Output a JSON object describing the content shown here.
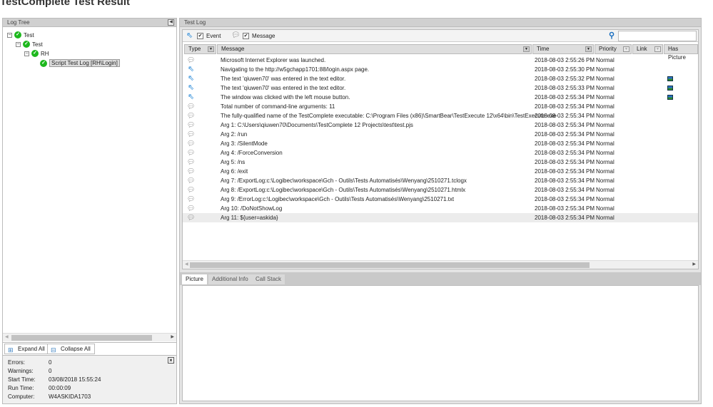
{
  "title": "TestComplete Test Result",
  "log_tree": {
    "header": "Log Tree",
    "nodes": [
      {
        "label": "Test"
      },
      {
        "label": "Test"
      },
      {
        "label": "RH"
      },
      {
        "label": "Script Test Log [RH\\Login]"
      }
    ],
    "expand_all": "Expand All",
    "collapse_all": "Collapse All"
  },
  "summary": {
    "rows": [
      {
        "key": "Errors:",
        "value": "0"
      },
      {
        "key": "Warnings:",
        "value": "0"
      },
      {
        "key": "Start Time:",
        "value": "03/08/2018 15:55:24"
      },
      {
        "key": "Run Time:",
        "value": "00:00:09"
      },
      {
        "key": "Computer:",
        "value": "W4ASKIDA1703"
      }
    ]
  },
  "test_log": {
    "header": "Test Log",
    "filters": {
      "event": "Event",
      "message": "Message"
    },
    "search_value": "",
    "columns": [
      "Type",
      "Message",
      "Time",
      "Priority",
      "Link",
      "Has Picture"
    ],
    "rows": [
      {
        "type": "message",
        "message": "Microsoft Internet Explorer was launched.",
        "time": "2018-08-03 2:55:26 PM",
        "priority": "Normal",
        "picture": false
      },
      {
        "type": "event",
        "message": "Navigating to the http://w5gchapp1701:88/login.aspx page.",
        "time": "2018-08-03 2:55:30 PM",
        "priority": "Normal",
        "picture": false
      },
      {
        "type": "event",
        "message": "The text 'qiuwen70' was entered in the text editor.",
        "time": "2018-08-03 2:55:32 PM",
        "priority": "Normal",
        "picture": true
      },
      {
        "type": "event",
        "message": "The text 'qiuwen70' was entered in the text editor.",
        "time": "2018-08-03 2:55:33 PM",
        "priority": "Normal",
        "picture": true
      },
      {
        "type": "event",
        "message": "The window was clicked with the left mouse button.",
        "time": "2018-08-03 2:55:34 PM",
        "priority": "Normal",
        "picture": true
      },
      {
        "type": "message",
        "message": "Total number of command-line arguments: 11",
        "time": "2018-08-03 2:55:34 PM",
        "priority": "Normal",
        "picture": false
      },
      {
        "type": "message",
        "message": "The fully-qualified name of the TestComplete executable: C:\\Program Files (x86)\\SmartBear\\TestExecute 12\\x64\\bin\\TestExecute.exe",
        "time": "2018-08-03 2:55:34 PM",
        "priority": "Normal",
        "picture": false
      },
      {
        "type": "message",
        "message": "Arg 1: C:\\Users\\qiuwen70\\Documents\\TestComplete 12 Projects\\test\\test.pjs",
        "time": "2018-08-03 2:55:34 PM",
        "priority": "Normal",
        "picture": false
      },
      {
        "type": "message",
        "message": "Arg 2: /run",
        "time": "2018-08-03 2:55:34 PM",
        "priority": "Normal",
        "picture": false
      },
      {
        "type": "message",
        "message": "Arg 3: /SilentMode",
        "time": "2018-08-03 2:55:34 PM",
        "priority": "Normal",
        "picture": false
      },
      {
        "type": "message",
        "message": "Arg 4: /ForceConversion",
        "time": "2018-08-03 2:55:34 PM",
        "priority": "Normal",
        "picture": false
      },
      {
        "type": "message",
        "message": "Arg 5: /ns",
        "time": "2018-08-03 2:55:34 PM",
        "priority": "Normal",
        "picture": false
      },
      {
        "type": "message",
        "message": "Arg 6: /exit",
        "time": "2018-08-03 2:55:34 PM",
        "priority": "Normal",
        "picture": false
      },
      {
        "type": "message",
        "message": "Arg 7: /ExportLog:c:\\Logibec\\workspace\\Gch - Outils\\Tests Automatisés\\Wenyang\\2510271.tclogx",
        "time": "2018-08-03 2:55:34 PM",
        "priority": "Normal",
        "picture": false
      },
      {
        "type": "message",
        "message": "Arg 8: /ExportLog:c:\\Logibec\\workspace\\Gch - Outils\\Tests Automatisés\\Wenyang\\2510271.htmlx",
        "time": "2018-08-03 2:55:34 PM",
        "priority": "Normal",
        "picture": false
      },
      {
        "type": "message",
        "message": "Arg 9: /ErrorLog:c:\\Logibec\\workspace\\Gch - Outils\\Tests Automatisés\\Wenyang\\2510271.txt",
        "time": "2018-08-03 2:55:34 PM",
        "priority": "Normal",
        "picture": false
      },
      {
        "type": "message",
        "message": "Arg 10: /DoNotShowLog",
        "time": "2018-08-03 2:55:34 PM",
        "priority": "Normal",
        "picture": false
      },
      {
        "type": "message",
        "message": "Arg 11: ${user=askida}",
        "time": "2018-08-03 2:55:34 PM",
        "priority": "Normal",
        "picture": false
      }
    ]
  },
  "details": {
    "tabs": [
      "Picture",
      "Additional Info",
      "Call Stack"
    ]
  }
}
